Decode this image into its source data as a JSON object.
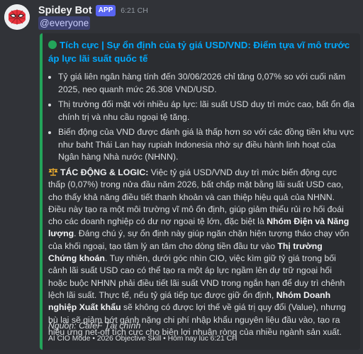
{
  "message": {
    "author": "Spidey Bot",
    "app_tag": "APP",
    "timestamp": "6:21 CH",
    "mention": "@everyone"
  },
  "embed": {
    "accent_color": "#23a55a",
    "title_icon": "green-circle-icon",
    "title": "Tích cực | Sự ổn định của tỷ giá USD/VND: Điểm tựa vĩ mô trước áp lực lãi suất quốc tế",
    "bullets": [
      "Tỷ giá liên ngân hàng tính đến 30/06/2026 chỉ tăng 0,07% so với cuối năm 2025, neo quanh mức 26.308 VND/USD.",
      "Thị trường đối mặt với nhiều áp lực: lãi suất USD duy trì mức cao, bất ổn địa chính trị và nhu cầu ngoại tệ tăng.",
      "Biến động của VND được đánh giá là thấp hơn so với các đồng tiền khu vực như baht Thái Lan hay rupiah Indonesia nhờ sự điều hành linh hoạt của Ngân hàng Nhà nước (NHNN)."
    ],
    "impact_icon": "balance-scale-icon",
    "impact_label": "TÁC ĐỘNG & LOGIC:",
    "impact_seg1": " Việc tỷ giá USD/VND duy trì mức biến động cực thấp (0,07%) trong nửa đầu năm 2026, bất chấp mặt bằng lãi suất USD cao, cho thấy khả năng điều tiết thanh khoản và can thiệp hiệu quả của NHNN. Điều này tạo ra một môi trường vĩ mô ổn định, giúp giảm thiểu rủi ro hối đoái cho các doanh nghiệp có dư nợ ngoại tệ lớn, đặc biệt là ",
    "impact_bold1": "Nhóm Điện và Năng lượng",
    "impact_seg2": ". Đáng chú ý, sự ổn định này giúp ngăn chặn hiện tượng tháo chạy vốn của khối ngoại, tạo tâm lý an tâm cho dòng tiền đầu tư vào ",
    "impact_bold2": "Thị trường Chứng khoán",
    "impact_seg3": ". Tuy nhiên, dưới góc nhìn CIO, việc kìm giữ tỷ giá trong bối cảnh lãi suất USD cao có thể tạo ra một áp lực ngầm lên dự trữ ngoại hối hoặc buộc NHNN phải điều tiết lãi suất VND trong ngắn hạn để duy trì chênh lệch lãi suất. Thực tế, nếu tỷ giá tiếp tục được giữ ổn định, ",
    "impact_bold3": "Nhóm Doanh nghiệp Xuất khẩu",
    "impact_seg4": " sẽ không có được lợi thế về giá trị quy đổi (Value), nhưng bù lại sẽ giảm bớt gánh nặng chi phí nhập khẩu nguyên liệu đầu vào, tạo ra hiệu ứng net-off tích cực cho biên lợi nhuận ròng của nhiều ngành sản xuất.",
    "source": "Nguồn: CafeF Tài chính",
    "footer": "AI CIO Mode • 2026 Objective Skill • Hôm nay lúc 6:21 CH"
  }
}
